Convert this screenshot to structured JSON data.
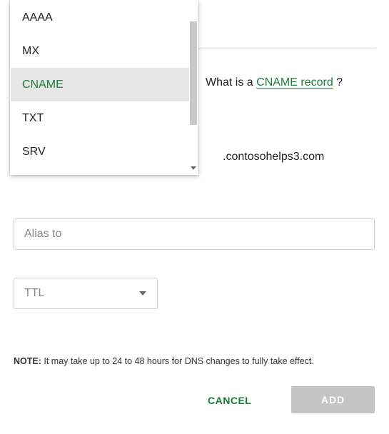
{
  "record_types": {
    "items": [
      {
        "label": "AAAA",
        "selected": false
      },
      {
        "label": "MX",
        "selected": false
      },
      {
        "label": "CNAME",
        "selected": true
      },
      {
        "label": "TXT",
        "selected": false
      },
      {
        "label": "SRV",
        "selected": false
      }
    ]
  },
  "help": {
    "prefix": "What is a ",
    "link_text": "CNAME record",
    "suffix": " ?"
  },
  "domain_suffix": ".contosohelps3.com",
  "alias": {
    "placeholder": "Alias to",
    "value": ""
  },
  "ttl": {
    "placeholder": "TTL"
  },
  "note": {
    "label": "NOTE:",
    "text": " It may take up to 24 to 48 hours for DNS changes to fully take effect."
  },
  "buttons": {
    "cancel": "CANCEL",
    "add": "ADD"
  }
}
